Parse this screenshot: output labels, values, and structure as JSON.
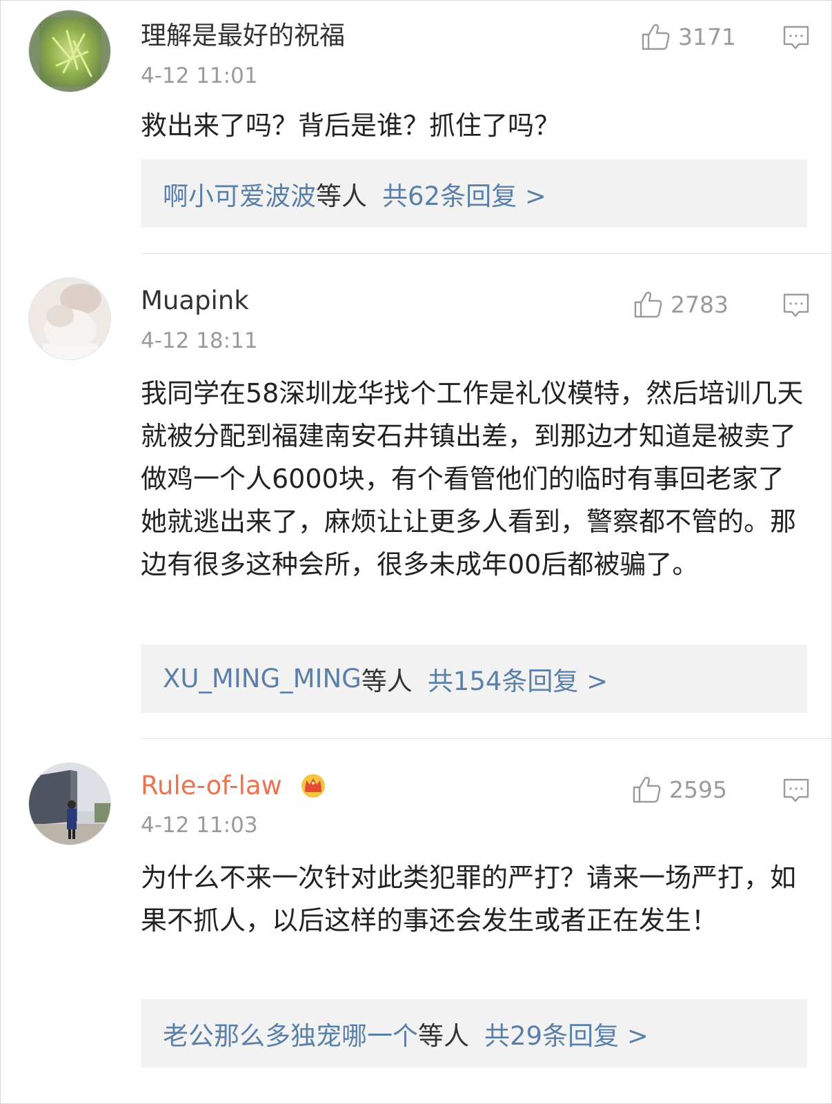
{
  "comments": [
    {
      "username": "理解是最好的祝福",
      "timestamp": "4-12 11:01",
      "likes": "3171",
      "text": "救出来了吗？背后是谁？抓住了吗？",
      "replies": {
        "names": "啊小可爱波波",
        "suffix": "等人",
        "count_text": "共62条回复 >"
      }
    },
    {
      "username": "Muapink",
      "timestamp": "4-12 18:11",
      "likes": "2783",
      "text": "我同学在58深圳龙华找个工作是礼仪模特，然后培训几天就被分配到福建南安石井镇出差，到那边才知道是被卖了做鸡一个人6000块，有个看管他们的临时有事回老家了她就逃出来了，麻烦让让更多人看到，警察都不管的。那边有很多这种会所，很多未成年00后都被骗了。",
      "replies": {
        "names": "XU_MING_MING",
        "suffix": "等人",
        "count_text": "共154条回复 >"
      }
    },
    {
      "username": "Rule-of-law",
      "timestamp": "4-12 11:03",
      "likes": "2595",
      "text": "为什么不来一次针对此类犯罪的严打？请来一场严打，如果不抓人，以后这样的事还会发生或者正在发生！",
      "replies": {
        "names": "老公那么多独宠哪一个",
        "suffix": "等人",
        "count_text": "共29条回复 >"
      }
    }
  ],
  "icons": {
    "like": "thumbs-up-icon",
    "reply": "comment-bubble-icon",
    "vip_badge": "crown-icon"
  },
  "colors": {
    "vip_username": "#eb7350",
    "reply_link": "#5a7fa8",
    "reply_box_bg": "#f2f2f2",
    "muted": "#9a9a9a"
  }
}
